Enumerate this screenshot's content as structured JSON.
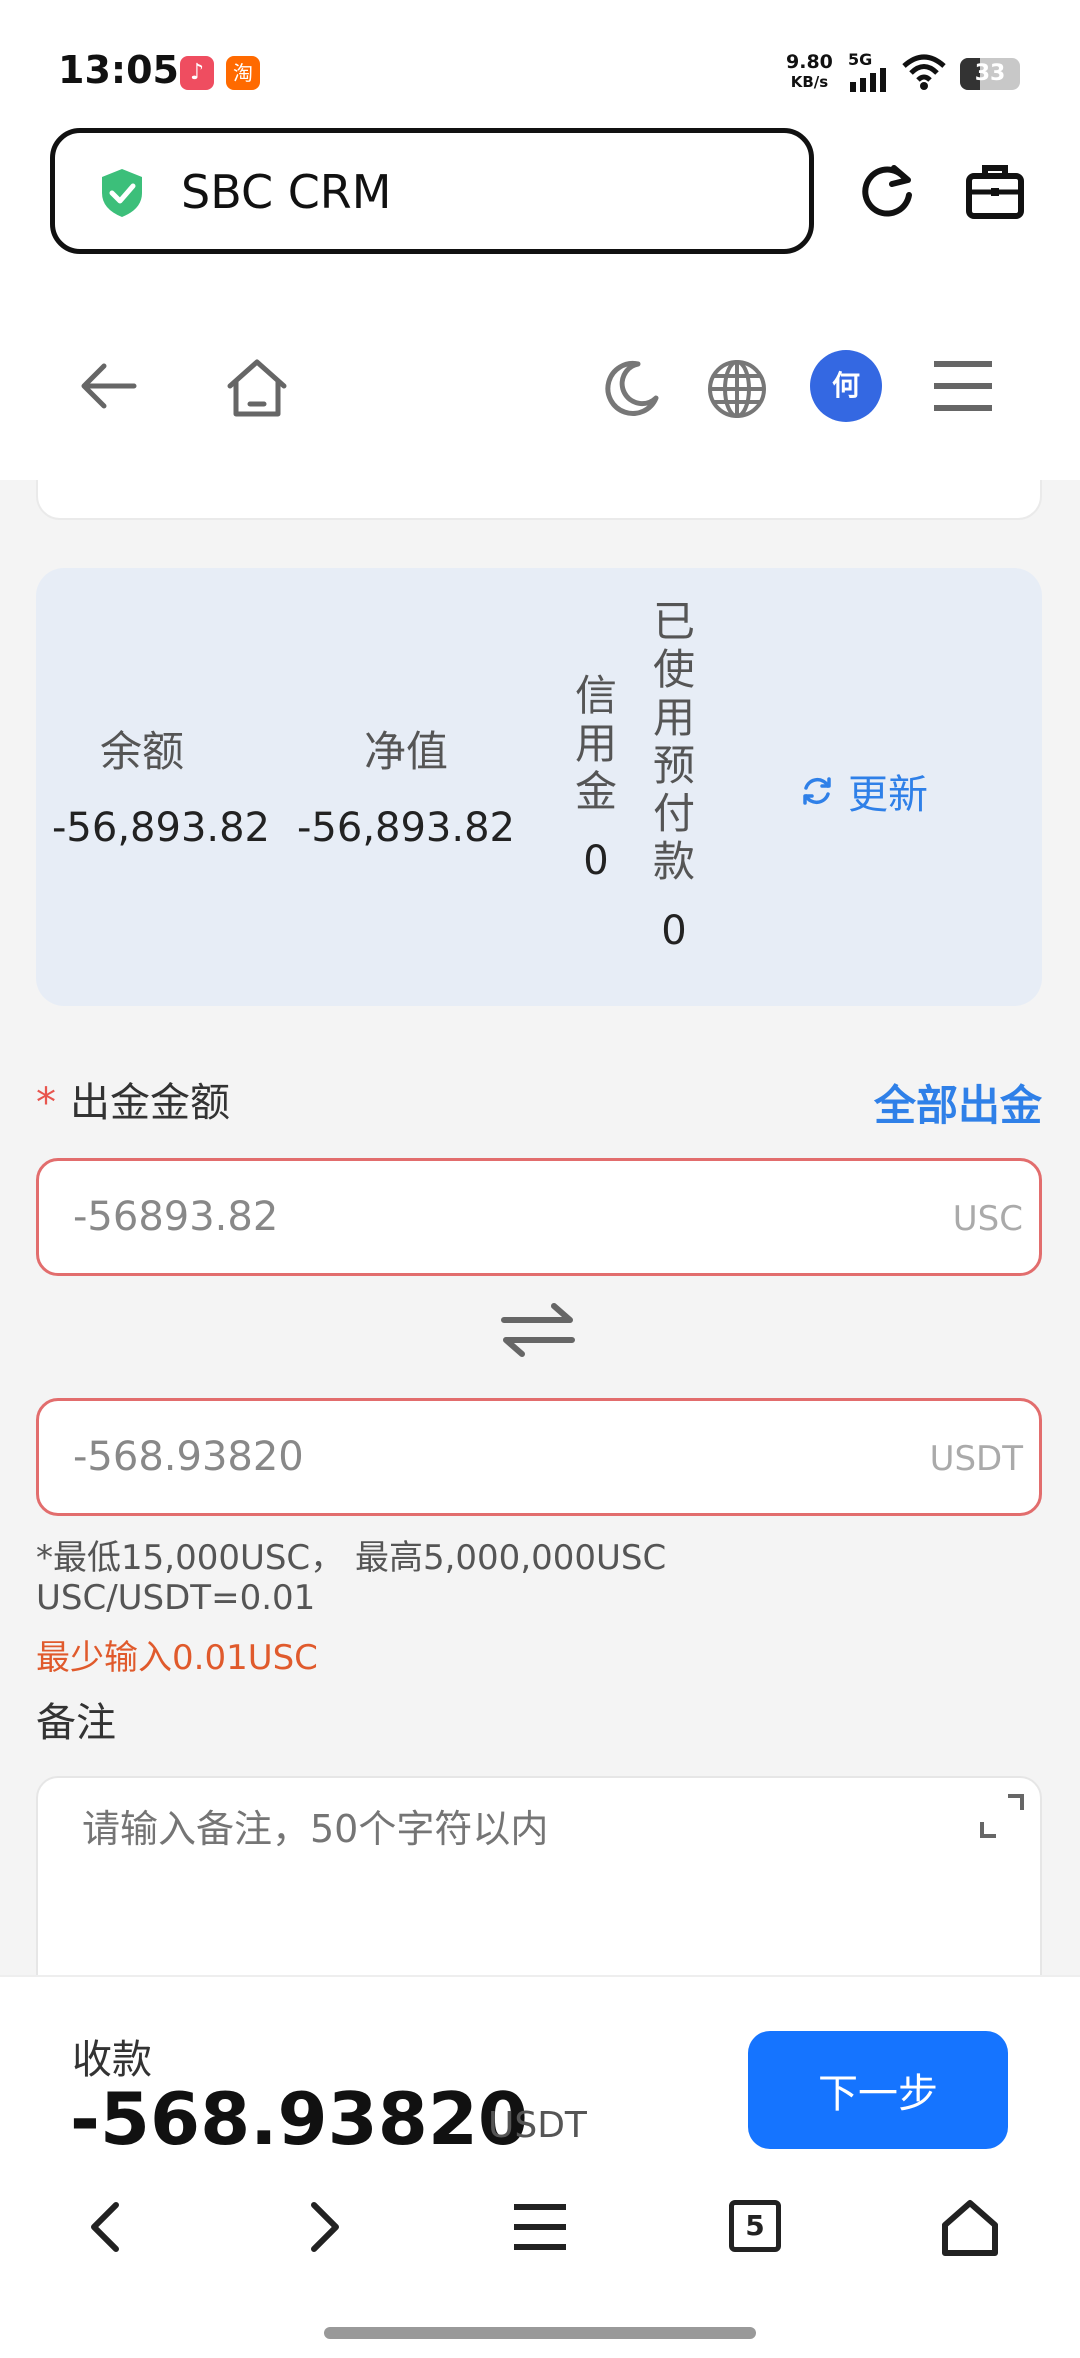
{
  "status_bar": {
    "time": "13:05",
    "app_badge_1": "♪",
    "app_badge_2": "淘",
    "net_speed": "9.80",
    "net_unit": "KB/s",
    "network_type": "5G",
    "battery": "33",
    "battery_level_pct": 33
  },
  "browser": {
    "url_title": "SBC CRM",
    "tab_count": "5"
  },
  "site_nav": {
    "avatar_initial": "何"
  },
  "balance": {
    "balance_label": "余额",
    "balance_value": "-56,893.82",
    "equity_label": "净值",
    "equity_value": "-56,893.82",
    "credit_label": "信用金",
    "credit_value": "0",
    "prepaid_label": "已使用预付款",
    "prepaid_value": "0",
    "refresh_label": "更新"
  },
  "withdraw": {
    "required_mark": "*",
    "amount_label": "出金金额",
    "withdraw_all": "全部出金",
    "amount_value": "-56893.82",
    "amount_unit": "USC",
    "converted_value": "-568.93820",
    "converted_unit": "USDT",
    "limits_hint": "*最低15,000USC， 最高5,000,000USC",
    "rate_hint": "USC/USDT=0.01",
    "error_text": "最少输入0.01USC",
    "note_label": "备注",
    "note_placeholder": "请输入备注，50个字符以内"
  },
  "footer": {
    "receive_label": "收款",
    "receive_amount": "-568.93820",
    "receive_unit": "USDT",
    "next_button": "下一步"
  },
  "colors": {
    "accent": "#1574ff",
    "link": "#2f80e8",
    "error": "#e05a2c",
    "card_bg": "#e7edf6",
    "avatar_bg": "#3468e2"
  }
}
